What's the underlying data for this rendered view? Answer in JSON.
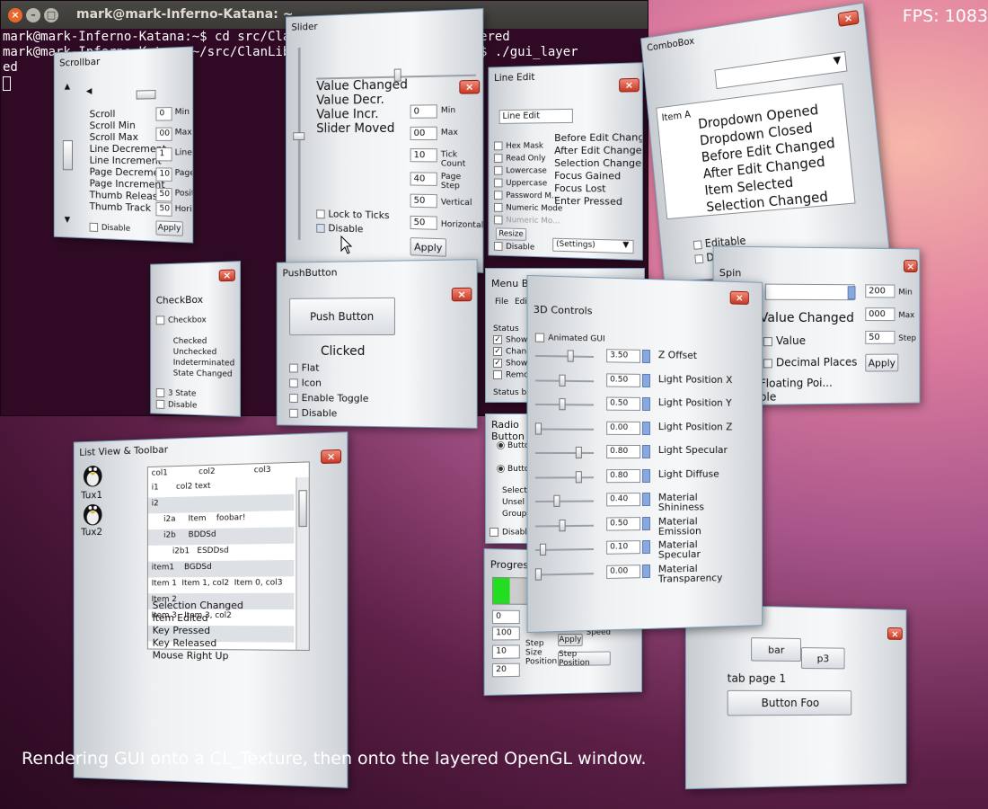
{
  "terminal": {
    "title": "mark@mark-Inferno-Katana: ~",
    "lines": [
      "mark@mark-Inferno-Katana:~$ cd src/ClanLib/Examples/GUI/GUI_Layered",
      "mark@mark-Inferno-Katana:~/src/ClanLib/Examples/GUI/GUI_Layered$ ./gui_layer",
      "ed"
    ]
  },
  "fps": "FPS: 1083",
  "caption": "Rendering GUI onto a CL_Texture, then onto the layered OpenGL window.",
  "scrollbar": {
    "title": "Scrollbar",
    "events": [
      "Scroll",
      "Scroll Min",
      "Scroll Max",
      "Line Decrement",
      "Line Increment",
      "Page Decrement",
      "Page Increment",
      "Thumb Release",
      "Thumb Track"
    ],
    "fields": [
      {
        "value": "0",
        "label": "Min"
      },
      {
        "value": "00",
        "label": "Max"
      },
      {
        "value": "1",
        "label": "Line"
      },
      {
        "value": "10",
        "label": "Page"
      },
      {
        "value": "50",
        "label": "Position"
      },
      {
        "value": "50",
        "label": "Horizontal"
      }
    ],
    "disable": "Disable",
    "apply": "Apply"
  },
  "slider": {
    "title": "Slider",
    "events": [
      "Value Changed",
      "Value Decr.",
      "Value Incr.",
      "Slider Moved"
    ],
    "fields": [
      {
        "value": "0",
        "label": "Min"
      },
      {
        "value": "00",
        "label": "Max"
      },
      {
        "value": "10",
        "label": "Tick Count"
      },
      {
        "value": "40",
        "label": "Page Step"
      },
      {
        "value": "50",
        "label": "Vertical"
      },
      {
        "value": "50",
        "label": "Horizontal"
      }
    ],
    "lock_to_ticks": "Lock to Ticks",
    "disable": "Disable",
    "apply": "Apply"
  },
  "lineedit": {
    "title": "Line Edit",
    "field_label": "Line Edit",
    "options": [
      "Hex Mask",
      "Read Only",
      "Lowercase",
      "Uppercase",
      "Password M...",
      "Numeric Mode",
      "Numeric Mo..."
    ],
    "events": [
      "Before Edit Change",
      "After Edit Changed",
      "Selection Changed",
      "Focus Gained",
      "Focus Lost",
      "Enter Pressed"
    ],
    "resize": "Resize",
    "disable": "Disable",
    "settings": "(Settings)"
  },
  "combobox": {
    "title": "ComboBox",
    "item": "Item A",
    "events": [
      "Dropdown Opened",
      "Dropdown Closed",
      "Before Edit Changed",
      "After Edit Changed",
      "Item Selected",
      "Selection Changed"
    ],
    "editable": "Editable",
    "disable": "Disable"
  },
  "checkbox": {
    "title": "CheckBox",
    "checkbox_label": "Checkbox",
    "events": [
      "Checked",
      "Unchecked",
      "Indeterminated",
      "State Changed"
    ],
    "three_state": "3 State",
    "disable": "Disable"
  },
  "pushbutton": {
    "title": "PushButton",
    "button": "Push Button",
    "status": "Clicked",
    "options": [
      "Flat",
      "Icon",
      "Enable Toggle",
      "Disable"
    ]
  },
  "menubar": {
    "title": "Menu Bar & Status Bar",
    "menus": [
      "File",
      "Edit"
    ],
    "status_label": "Status",
    "options": [
      "Show S",
      "Change",
      "Show C",
      "Remov"
    ],
    "status_bar": "Status ba"
  },
  "radio": {
    "title": "Radio Button",
    "buttons": [
      "Button",
      "Button"
    ],
    "texts": [
      "Select",
      "Unsel",
      "Group"
    ],
    "disable": "Disable"
  },
  "progress": {
    "title": "Progress B",
    "fields": [
      "0",
      "100",
      "10",
      "20"
    ],
    "labels": [
      "Step",
      "Size",
      "Position"
    ],
    "speed": "Speed",
    "apply": "Apply",
    "step_position": "Step Position",
    "progress_value": 0.12
  },
  "spin": {
    "title": "Spin",
    "event": "Value Changed",
    "value_label": "Value",
    "decimal": "Decimal Places",
    "floating": "Floating Poi...",
    "able": "ble",
    "fields": [
      {
        "value": "200",
        "label": "Min"
      },
      {
        "value": "000",
        "label": "Max"
      },
      {
        "value": "50",
        "label": "Step"
      }
    ],
    "apply": "Apply"
  },
  "listview": {
    "title": "List View & Toolbar",
    "toolbar": [
      "Tux1",
      "Tux2"
    ],
    "columns": [
      "col1",
      "col2",
      "col3"
    ],
    "rows": [
      [
        "i1",
        "col2 text",
        ""
      ],
      [
        "i2",
        "",
        ""
      ],
      [
        "i2a",
        "Item",
        "foobar!"
      ],
      [
        "i2b",
        "BDDSd",
        ""
      ],
      [
        "i2b1",
        "ESDDsd",
        ""
      ],
      [
        "item1",
        "BGDSd",
        ""
      ],
      [
        "Item 1",
        "Item 1, col2",
        "Item 0, col3"
      ],
      [
        "Item 2",
        "",
        ""
      ],
      [
        "Item 3",
        "Item 3, col2",
        ""
      ]
    ],
    "events": [
      "Selection Changed",
      "Item Edited",
      "Key Pressed",
      "Key Released",
      "Mouse Right Up"
    ]
  },
  "controls3d": {
    "title": "3D Controls",
    "animated": "Animated GUI",
    "params": [
      {
        "value": "3.50",
        "label": "Z Offset",
        "level": 0.6
      },
      {
        "value": "0.50",
        "label": "Light Position X",
        "level": 0.45
      },
      {
        "value": "0.50",
        "label": "Light Position Y",
        "level": 0.45
      },
      {
        "value": "0.00",
        "label": "Light Position Z",
        "level": 0.0
      },
      {
        "value": "0.80",
        "label": "Light Specular",
        "level": 0.75
      },
      {
        "value": "0.80",
        "label": "Light Diffuse",
        "level": 0.75
      },
      {
        "value": "0.40",
        "label": "Material Shininess",
        "level": 0.35
      },
      {
        "value": "0.50",
        "label": "Material Emission",
        "level": 0.45
      },
      {
        "value": "0.10",
        "label": "Material Specular",
        "level": 0.08
      },
      {
        "value": "0.00",
        "label": "Material Transparency",
        "level": 0.0
      }
    ]
  },
  "tabs": {
    "tabs": [
      "bar",
      "p3"
    ],
    "page": "tab page 1",
    "button": "Button Foo"
  },
  "colors": {
    "accent": "#7a9fbd",
    "close": "#c83a26",
    "progress": "#22dd22",
    "terminal_bg": "#300a24"
  }
}
